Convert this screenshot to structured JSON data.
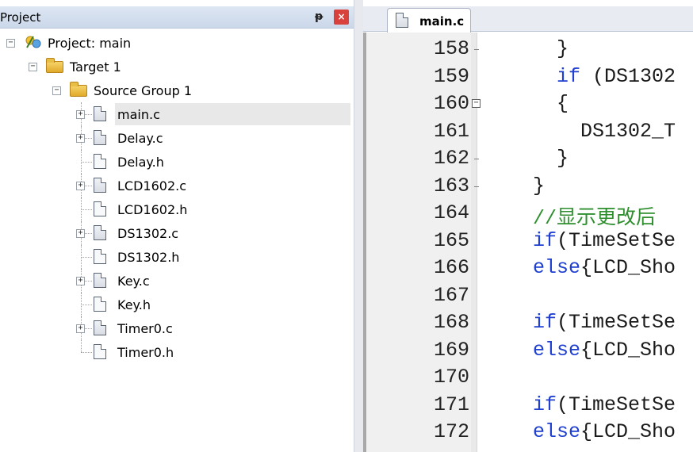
{
  "project_panel": {
    "title": "Project",
    "pin_glyph": "ᵽ",
    "close_glyph": "×",
    "tree": [
      {
        "label": "Project: main",
        "kind": "project",
        "level": 0,
        "expander": "−"
      },
      {
        "label": "Target 1",
        "kind": "target",
        "level": 1,
        "expander": "−"
      },
      {
        "label": "Source Group 1",
        "kind": "folder",
        "level": 2,
        "expander": "−"
      },
      {
        "label": "main.c",
        "kind": "c-file",
        "level": 3,
        "expander": "+",
        "selected": true
      },
      {
        "label": "Delay.c",
        "kind": "c-file",
        "level": 3,
        "expander": "+"
      },
      {
        "label": "Delay.h",
        "kind": "h-file",
        "level": 3,
        "expander": ""
      },
      {
        "label": "LCD1602.c",
        "kind": "c-file",
        "level": 3,
        "expander": "+"
      },
      {
        "label": "LCD1602.h",
        "kind": "h-file",
        "level": 3,
        "expander": ""
      },
      {
        "label": "DS1302.c",
        "kind": "c-file",
        "level": 3,
        "expander": "+"
      },
      {
        "label": "DS1302.h",
        "kind": "h-file",
        "level": 3,
        "expander": ""
      },
      {
        "label": "Key.c",
        "kind": "c-file",
        "level": 3,
        "expander": "+"
      },
      {
        "label": "Key.h",
        "kind": "h-file",
        "level": 3,
        "expander": ""
      },
      {
        "label": "Timer0.c",
        "kind": "c-file",
        "level": 3,
        "expander": "+"
      },
      {
        "label": "Timer0.h",
        "kind": "h-file",
        "level": 3,
        "expander": ""
      }
    ]
  },
  "editor": {
    "active_tab": "main.c",
    "lines": [
      {
        "num": "158",
        "fold": "line",
        "parts": [
          {
            "t": "      }",
            "c": ""
          }
        ]
      },
      {
        "num": "159",
        "fold": "",
        "parts": [
          {
            "t": "      ",
            "c": ""
          },
          {
            "t": "if",
            "c": "kw"
          },
          {
            "t": " (DS1302",
            "c": ""
          }
        ]
      },
      {
        "num": "160",
        "fold": "box",
        "parts": [
          {
            "t": "      {",
            "c": ""
          }
        ]
      },
      {
        "num": "161",
        "fold": "",
        "parts": [
          {
            "t": "        DS1302_T",
            "c": ""
          }
        ]
      },
      {
        "num": "162",
        "fold": "line",
        "parts": [
          {
            "t": "      }",
            "c": ""
          }
        ]
      },
      {
        "num": "163",
        "fold": "line",
        "parts": [
          {
            "t": "    }",
            "c": ""
          }
        ]
      },
      {
        "num": "164",
        "fold": "",
        "parts": [
          {
            "t": "    //显示更改后",
            "c": "cm"
          }
        ]
      },
      {
        "num": "165",
        "fold": "",
        "parts": [
          {
            "t": "    ",
            "c": ""
          },
          {
            "t": "if",
            "c": "kw"
          },
          {
            "t": "(TimeSetSe",
            "c": ""
          }
        ]
      },
      {
        "num": "166",
        "fold": "",
        "parts": [
          {
            "t": "    ",
            "c": ""
          },
          {
            "t": "else",
            "c": "kw"
          },
          {
            "t": "{LCD_Sho",
            "c": ""
          }
        ]
      },
      {
        "num": "167",
        "fold": "",
        "parts": [
          {
            "t": "",
            "c": ""
          }
        ]
      },
      {
        "num": "168",
        "fold": "",
        "parts": [
          {
            "t": "    ",
            "c": ""
          },
          {
            "t": "if",
            "c": "kw"
          },
          {
            "t": "(TimeSetSe",
            "c": ""
          }
        ]
      },
      {
        "num": "169",
        "fold": "",
        "parts": [
          {
            "t": "    ",
            "c": ""
          },
          {
            "t": "else",
            "c": "kw"
          },
          {
            "t": "{LCD_Sho",
            "c": ""
          }
        ]
      },
      {
        "num": "170",
        "fold": "",
        "parts": [
          {
            "t": "",
            "c": ""
          }
        ]
      },
      {
        "num": "171",
        "fold": "",
        "parts": [
          {
            "t": "    ",
            "c": ""
          },
          {
            "t": "if",
            "c": "kw"
          },
          {
            "t": "(TimeSetSe",
            "c": ""
          }
        ]
      },
      {
        "num": "172",
        "fold": "",
        "parts": [
          {
            "t": "    ",
            "c": ""
          },
          {
            "t": "else",
            "c": "kw"
          },
          {
            "t": "{LCD_Sho",
            "c": ""
          }
        ]
      }
    ]
  }
}
